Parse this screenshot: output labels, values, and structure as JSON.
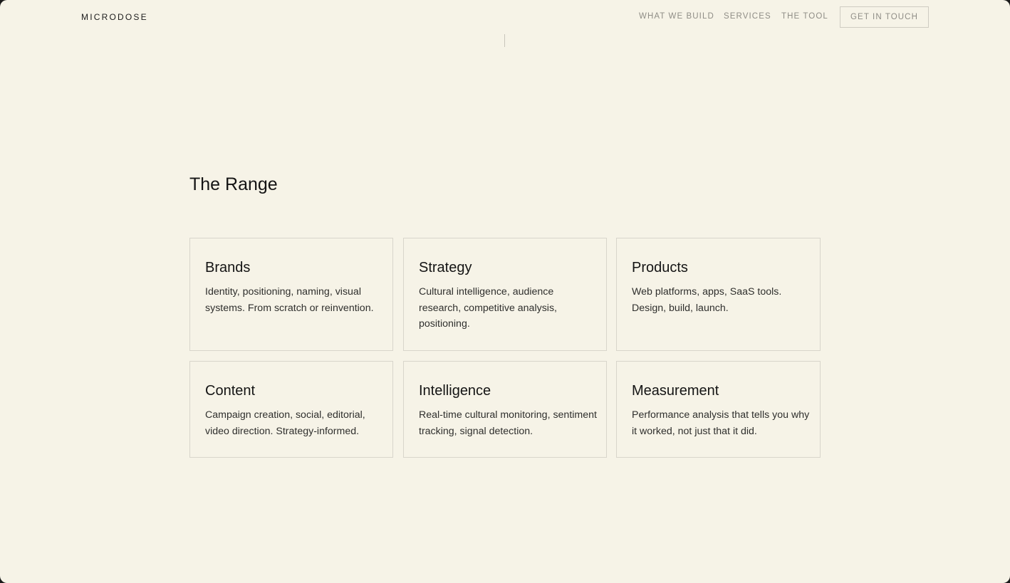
{
  "header": {
    "logo": "MICRODOSE",
    "nav": [
      {
        "label": "WHAT WE BUILD"
      },
      {
        "label": "SERVICES"
      },
      {
        "label": "THE TOOL"
      }
    ],
    "cta_label": "GET IN TOUCH"
  },
  "range": {
    "title": "The Range",
    "cards": [
      {
        "title": "Brands",
        "description": "Identity, positioning, naming, visual systems. From scratch or reinvention."
      },
      {
        "title": "Strategy",
        "description": "Cultural intelligence, audience research, competitive analysis, positioning."
      },
      {
        "title": "Products",
        "description": "Web platforms, apps, SaaS tools. Design, build, launch."
      },
      {
        "title": "Content",
        "description": "Campaign creation, social, editorial, video direction. Strategy-informed."
      },
      {
        "title": "Intelligence",
        "description": "Real-time cultural monitoring, sentiment tracking, signal detection."
      },
      {
        "title": "Measurement",
        "description": "Performance analysis that tells you why it worked, not just that it did."
      }
    ]
  },
  "colors": {
    "background": "#f6f3e7",
    "text": "#141414",
    "muted": "#8f8d86",
    "border": "#d8d5cb"
  }
}
